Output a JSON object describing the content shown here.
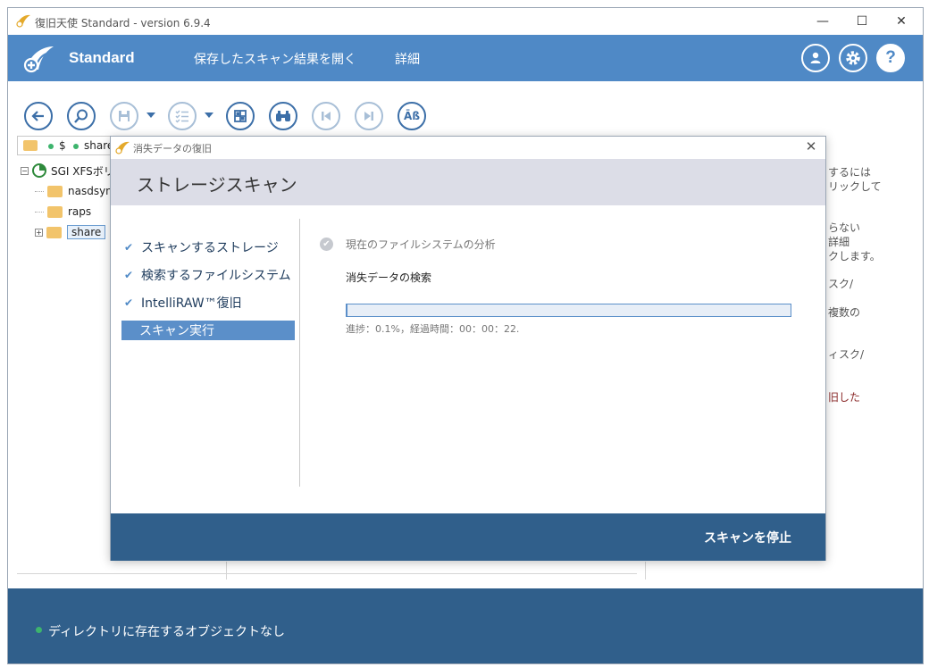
{
  "window": {
    "title": "復旧天使 Standard - version 6.9.4",
    "controls": {
      "minimize": "—",
      "maximize": "☐",
      "close": "✕"
    }
  },
  "header": {
    "brand": "Standard",
    "menu": [
      "保存したスキャン結果を開く",
      "詳細"
    ],
    "icons": [
      "user-icon",
      "gear-icon",
      "help-icon"
    ]
  },
  "toolbar": {
    "buttons": [
      "back-icon",
      "search-icon",
      "save-icon",
      "checklist-icon",
      "grid-icon",
      "binoculars-icon",
      "prev-icon",
      "next-icon",
      "text-case-icon"
    ],
    "case_label": "Āß"
  },
  "pathbar": {
    "segments": [
      "$",
      "share"
    ]
  },
  "tree": {
    "root": "SGI XFSボリ",
    "items": [
      "nasdsync",
      "raps",
      "share"
    ]
  },
  "right_info": [
    "するには",
    "リックして",
    "らない",
    "詳細",
    "クします。",
    "スク/",
    "複数の",
    "ィスク/",
    "旧した"
  ],
  "status": {
    "text": "ディレクトリに存在するオブジェクトなし",
    "dot_color": "#3db46d"
  },
  "dialog": {
    "title": "消失データの復旧",
    "heading": "ストレージスキャン",
    "steps": [
      {
        "label": "スキャンするストレージ",
        "done": true
      },
      {
        "label": "検索するファイルシステム",
        "done": true
      },
      {
        "label": "IntelliRAW™復旧",
        "done": true
      },
      {
        "label": "スキャン実行",
        "active": true
      }
    ],
    "task_done": "現在のファイルシステムの分析",
    "task_current": "消失データの検索",
    "progress_fraction": 0.001,
    "progress_text": "進捗：0.1%，経過時間：00：00：22.",
    "stop_button": "スキャンを停止"
  },
  "colors": {
    "accent": "#4f89c6",
    "dark": "#305f8b",
    "head_bg": "#dcdde7"
  }
}
